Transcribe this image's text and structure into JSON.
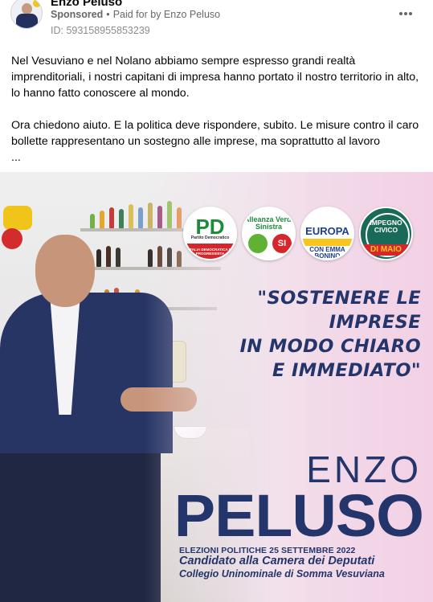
{
  "post": {
    "page_name": "Enzo Peluso",
    "sponsored": "Sponsored",
    "separator": "•",
    "paid_for": "Paid for by Enzo Peluso",
    "ad_id": "ID: 593158955853239",
    "more_icon": "more-horizontal-icon",
    "caption": {
      "p1": "Nel Vesuviano e nel Nolano abbiamo sempre espresso grandi realtà imprenditoriali, i nostri capitani di impresa hanno portato il nostro territorio in alto, lo hanno fatto conoscere al mondo.",
      "p2": "Ora chiedono aiuto. E la politica deve rispondere, subito. Le misure contro il caro bollette rappresentano un sostegno alle imprese, ma soprattutto al lavoro",
      "ellipsis": "..."
    }
  },
  "creative": {
    "logos": {
      "pd_mark": "PD",
      "pd_name": "Partito Democratico",
      "pd_band": "ITALIA DEMOCRATICA E PROGRESSISTA",
      "avs_name": "Alleanza Verdi Sinistra",
      "avs_si": "SI",
      "europa_name": "EUROPA",
      "europa_with": "CON EMMA BONINO",
      "ic_name": "IMPEGNO CIVICO",
      "ic_leader": "DI MAIO"
    },
    "quote": [
      "\"SOSTENERE LE",
      "IMPRESE",
      "IN MODO CHIARO",
      "E IMMEDIATO\""
    ],
    "first_name": "ENZO",
    "last_name": "PELUSO",
    "election": "ELEZIONI POLITICHE 25 SETTEMBRE 2022",
    "candidacy": "Candidato alla Camera dei Deputati",
    "constituency": "Collegio Uninominale di Somma Vesuviana"
  },
  "colors": {
    "navy": "#24356b",
    "meta_gray": "#65676b",
    "pink_bg": "#f3d0e5"
  }
}
